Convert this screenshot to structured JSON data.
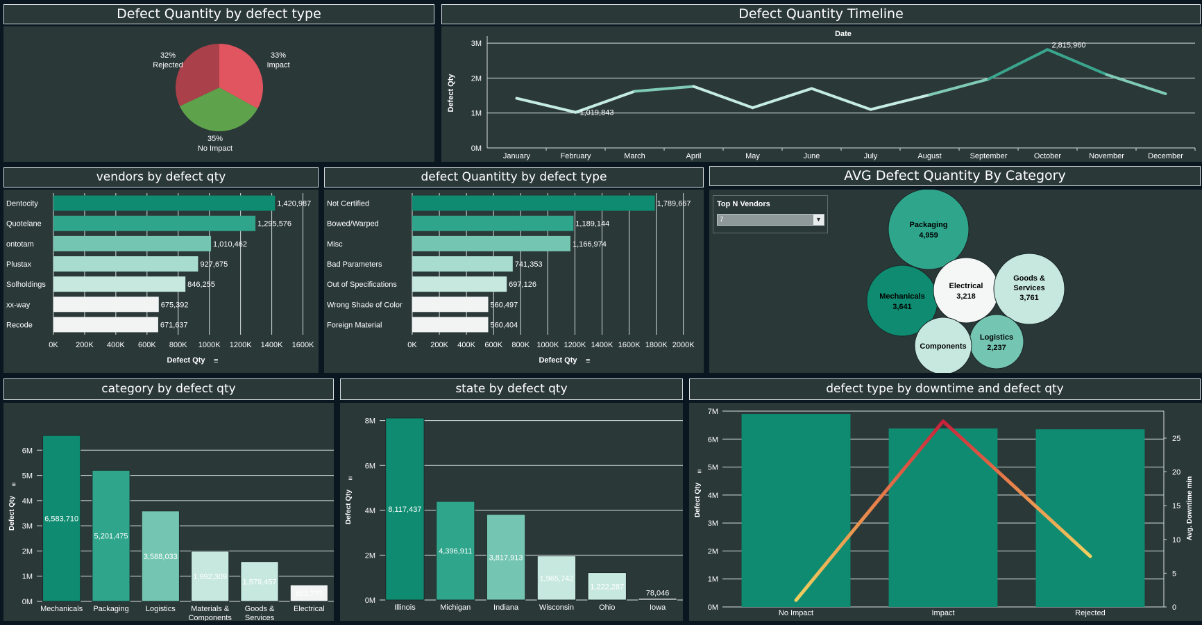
{
  "colors": {
    "teal_dark": "#0e8b70",
    "teal_mid": "#2fa58c",
    "teal_light": "#74c6b3",
    "teal_pale": "#a8dccf",
    "teal_faint": "#c7e8df",
    "white_bar": "#f2f4f4",
    "pie_impact": "#e05560",
    "pie_no_impact": "#5ea34b",
    "pie_rejected": "#a9404a",
    "panel_bg": "#2b3838",
    "line_light": "#c5ece1",
    "line_dark": "#3aa68d"
  },
  "panels": {
    "pie_title": "Defect Quantity by defect type",
    "timeline_title": "Defect Quantity Timeline",
    "vendors_title": "vendors by defect qty",
    "type_title": "defect Quantitty by defect type",
    "avg_title": "AVG Defect Quantity By Category",
    "category_title": "category by defect qty",
    "state_title": "state by defect qty",
    "downtime_title": "defect type by downtime and defect qty"
  },
  "filter": {
    "label": "Top N Vendors",
    "value": "7"
  },
  "chart_data": [
    {
      "id": "pie",
      "type": "pie",
      "slices": [
        {
          "name": "Impact",
          "pct_label": "33%",
          "value": 33
        },
        {
          "name": "No Impact",
          "pct_label": "35%",
          "value": 35
        },
        {
          "name": "Rejected",
          "pct_label": "32%",
          "value": 32
        }
      ]
    },
    {
      "id": "timeline",
      "type": "line",
      "x_title": "Date",
      "ylabel": "Defect Qty",
      "categories": [
        "January",
        "February",
        "March",
        "April",
        "May",
        "June",
        "July",
        "August",
        "September",
        "October",
        "November",
        "December"
      ],
      "values": [
        1420000,
        1019843,
        1620000,
        1760000,
        1150000,
        1700000,
        1100000,
        1520000,
        1970000,
        2815960,
        2100000,
        1550000
      ],
      "data_labels": [
        null,
        "1,019,843",
        null,
        null,
        null,
        null,
        null,
        null,
        null,
        "2,815,960",
        null,
        null
      ],
      "yticks": [
        "0M",
        "1M",
        "2M",
        "3M"
      ],
      "ylim": [
        0,
        3200000
      ]
    },
    {
      "id": "vendors",
      "type": "bar",
      "orientation": "horizontal",
      "xlabel": "Defect Qty",
      "categories": [
        "Dentocity",
        "Quotelane",
        "ontotam",
        "Plustax",
        "Solholdings",
        "xx-way",
        "Recode"
      ],
      "values": [
        1420987,
        1295576,
        1010462,
        927675,
        846255,
        675392,
        671637
      ],
      "value_labels": [
        "1,420,987",
        "1,295,576",
        "1,010,462",
        "927,675",
        "846,255",
        "675,392",
        "671,637"
      ],
      "xticks": [
        "0K",
        "200K",
        "400K",
        "600K",
        "800K",
        "1000K",
        "1200K",
        "1400K",
        "1600K"
      ],
      "xlim": [
        0,
        1700000
      ]
    },
    {
      "id": "types",
      "type": "bar",
      "orientation": "horizontal",
      "xlabel": "Defect Qty",
      "categories": [
        "Not Certified",
        "Bowed/Warped",
        "Misc",
        "Bad Parameters",
        "Out of Specifications",
        "Wrong Shade of Color",
        "Foreign Material"
      ],
      "values": [
        1789667,
        1189144,
        1166974,
        741353,
        697126,
        560497,
        560404
      ],
      "value_labels": [
        "1,789,667",
        "1,189,144",
        "1,166,974",
        "741,353",
        "697,126",
        "560,497",
        "560,404"
      ],
      "xticks": [
        "0K",
        "200K",
        "400K",
        "600K",
        "800K",
        "1000K",
        "1200K",
        "1400K",
        "1600K",
        "1800K",
        "2000K"
      ],
      "xlim": [
        0,
        2150000
      ]
    },
    {
      "id": "bubbles",
      "type": "bubble",
      "items": [
        {
          "name": "Packaging",
          "label": "4,959",
          "value": 4959
        },
        {
          "name": "Mechanicals",
          "label": "3,641",
          "value": 3641
        },
        {
          "name": "Electrical",
          "label": "3,218",
          "value": 3218
        },
        {
          "name": "Goods & Services",
          "label": "3,761",
          "value": 3761
        },
        {
          "name": "Logistics",
          "label": "2,237",
          "value": 2237
        },
        {
          "name": "Components",
          "label": "",
          "value": 2000
        }
      ]
    },
    {
      "id": "category",
      "type": "bar",
      "ylabel": "Defect Qty",
      "categories": [
        "Mechanicals",
        "Packaging",
        "Logistics",
        "Materials & Components",
        "Goods & Services",
        "Electrical"
      ],
      "values": [
        6583710,
        5201475,
        3588033,
        1992309,
        1579457,
        653000
      ],
      "value_labels": [
        "6,583,710",
        "5,201,475",
        "3,588,033",
        "1,992,309",
        "1,579,457",
        "653,???"
      ],
      "yticks": [
        "0M",
        "1M",
        "2M",
        "3M",
        "4M",
        "5M",
        "6M"
      ],
      "ylim": [
        0,
        7000000
      ]
    },
    {
      "id": "state",
      "type": "bar",
      "ylabel": "Defect Qty",
      "categories": [
        "Illinois",
        "Michigan",
        "Indiana",
        "Wisconsin",
        "Ohio",
        "Iowa"
      ],
      "values": [
        8117437,
        4396911,
        3817913,
        1965742,
        1222287,
        78046
      ],
      "value_labels": [
        "8,117,437",
        "4,396,911",
        "3,817,913",
        "1,965,742",
        "1,222,287",
        "78,046"
      ],
      "yticks": [
        "0M",
        "2M",
        "4M",
        "6M",
        "8M"
      ],
      "ylim": [
        0,
        8300000
      ]
    },
    {
      "id": "downtime",
      "type": "bar",
      "ylabel": "Defect Qty",
      "y2label": "Avg. Downtime min",
      "categories": [
        "No Impact",
        "Impact",
        "Rejected"
      ],
      "values": [
        6900000,
        6380000,
        6350000
      ],
      "downtime": [
        1,
        27.5,
        7.5
      ],
      "yticks": [
        "0M",
        "1M",
        "2M",
        "3M",
        "4M",
        "5M",
        "6M",
        "7M"
      ],
      "ylim": [
        0,
        7000000
      ],
      "y2ticks": [
        "0",
        "5",
        "10",
        "15",
        "20",
        "25"
      ],
      "y2lim": [
        0,
        29
      ]
    }
  ]
}
